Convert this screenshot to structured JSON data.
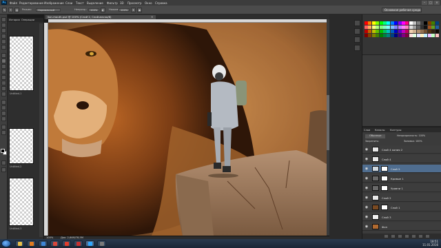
{
  "menubar": {
    "app_logo": "Ps",
    "items": [
      "Файл",
      "Редактирование",
      "Изображение",
      "Слои",
      "Текст",
      "Выделение",
      "Фильтр",
      "3D",
      "Просмотр",
      "Окно",
      "Справка"
    ],
    "window_controls": [
      "–",
      "□",
      "×"
    ]
  },
  "options": {
    "mode_value": "Нормальный",
    "opacity_label": "Непрозр.:",
    "opacity_value": "100%",
    "flow_label": "Нажим:",
    "flow_value": "100%",
    "essentials": "Основная рабочая среда"
  },
  "history": {
    "tabs": [
      "История",
      "Операции"
    ],
    "thumb_labels": [
      "Untitled-1",
      "Untitled-2",
      "Untitled-3"
    ]
  },
  "document": {
    "tab_title": "lion-mouth.psd @ 100% (Слой 2, Слой-маска/8)",
    "close_glyph": "×",
    "status_zoom": "100%",
    "status_doc": "Док: 2,64М/78,5М"
  },
  "layers": {
    "tabs": [
      "Слои",
      "Каналы",
      "Контуры"
    ],
    "blend_label": "Обычные",
    "opacity_label": "Непрозрачность: 100%",
    "lock_label": "Закрепить:",
    "fill_label": "Заливка: 100%",
    "rows": [
      {
        "name": "Слой 4 копия 2",
        "visible": true,
        "selected": false,
        "has_mask": false,
        "thumb_color": "#e8e8e8"
      },
      {
        "name": "Слой 4",
        "visible": true,
        "selected": false,
        "has_mask": false,
        "thumb_color": "#e8e8e8"
      },
      {
        "name": "Слой 5",
        "visible": true,
        "selected": true,
        "has_mask": true,
        "thumb_color": "#cfd8e0"
      },
      {
        "name": "Кривые 1",
        "visible": true,
        "selected": false,
        "has_mask": true,
        "thumb_color": "#6a6a6a"
      },
      {
        "name": "Уровни 1",
        "visible": true,
        "selected": false,
        "has_mask": true,
        "thumb_color": "#6a6a6a"
      },
      {
        "name": "Слой 2",
        "visible": true,
        "selected": false,
        "has_mask": false,
        "thumb_color": "#e6e6e6"
      },
      {
        "name": "Слой 1",
        "visible": true,
        "selected": false,
        "has_mask": true,
        "thumb_color": "#7a4a22"
      },
      {
        "name": "Слой 3",
        "visible": true,
        "selected": false,
        "has_mask": false,
        "thumb_color": "#f0f0f0"
      },
      {
        "name": "Фон",
        "visible": true,
        "selected": false,
        "has_mask": false,
        "thumb_color": "#b06a30"
      }
    ]
  },
  "taskbar": {
    "time": "18:51",
    "date": "11.01.2016",
    "apps": [
      {
        "name": "explorer",
        "color": "#e8c04a"
      },
      {
        "name": "media-player",
        "color": "#e07a20"
      },
      {
        "name": "browser",
        "color": "#3f86d6"
      },
      {
        "name": "chrome",
        "color": "#d8463a"
      },
      {
        "name": "yandex",
        "color": "#e03c2c"
      },
      {
        "name": "player",
        "color": "#c83030"
      },
      {
        "name": "photoshop",
        "color": "#31a8ff"
      },
      {
        "name": "paint",
        "color": "#7a7a7a"
      }
    ]
  },
  "colors": {
    "ui_dark": "#323232",
    "selection_blue": "#4f6d8f",
    "accent_ps": "#31a8ff"
  }
}
